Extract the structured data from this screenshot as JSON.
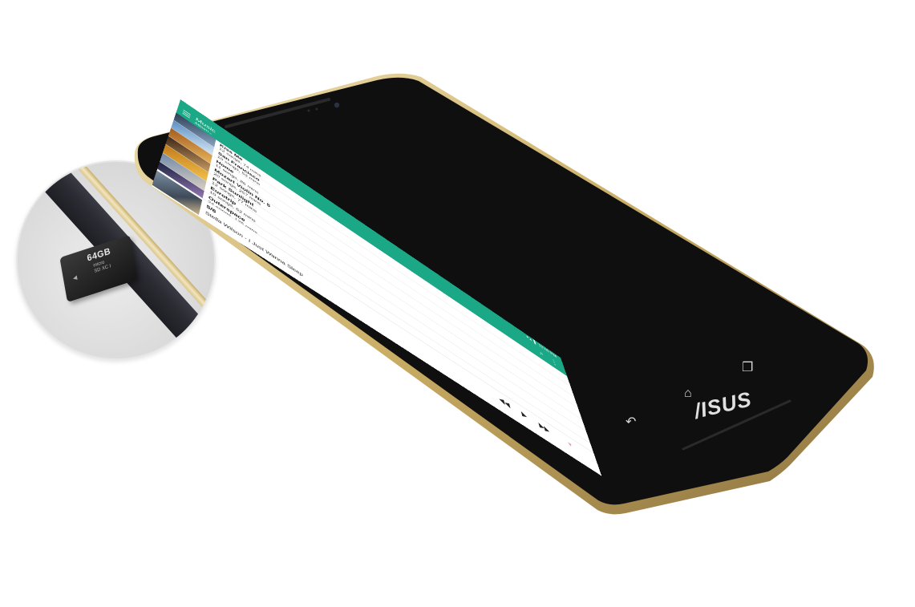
{
  "status_bar": {
    "time": "12:00 PM",
    "signal": "▾▴▐"
  },
  "app_bar": {
    "title": "Music",
    "subtitle": "Album",
    "dropdown_icon": "chevron-down-icon"
  },
  "albums": [
    {
      "title": "Kiss Me",
      "meta": "12 songs, 74 mins",
      "color1": "#2c3e55",
      "color2": "#8aa3c0"
    },
    {
      "title": "San Francisco",
      "meta": "10 songs, 53 mins",
      "color1": "#5a8fc4",
      "color2": "#d7e6f2"
    },
    {
      "title": "Home",
      "meta": "11 songs, 86 mins",
      "color1": "#a35c1f",
      "color2": "#e8b45a"
    },
    {
      "title": "Mozart Violin No. 5",
      "meta": "20 songs, 257 mins",
      "color1": "#3b2616",
      "color2": "#c89a62"
    },
    {
      "title": "Park Sunlight",
      "meta": "12 songs, 77 mins",
      "color1": "#c07a1a",
      "color2": "#f3c04a"
    },
    {
      "title": "Eurotrip",
      "meta": "10 songs, 62 mins",
      "color1": "#6f89aa",
      "color2": "#d9cfc0"
    },
    {
      "title": "Outerspace",
      "meta": "24 songs, 125 mins",
      "color1": "#1a2340",
      "color2": "#9a7bb8"
    }
  ],
  "now_playing": {
    "count": "5/6",
    "song": "Stella Wilson - I Just Wanna Sleep"
  },
  "sd_card": {
    "capacity": "64GB"
  },
  "brand": "/ISUS",
  "colors": {
    "accent": "#1aa887",
    "bezel": "#111111",
    "trim": "#d6c48e"
  }
}
